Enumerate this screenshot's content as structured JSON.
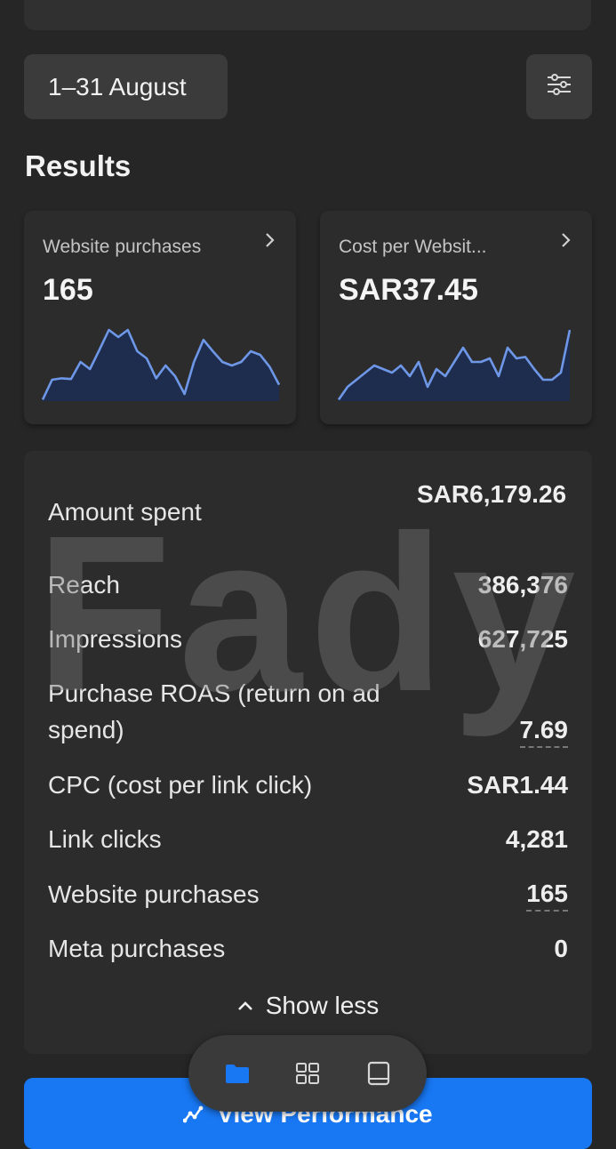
{
  "header": {
    "date_range": "1–31 August",
    "section_title": "Results"
  },
  "metrics": [
    {
      "label": "Website purchases",
      "value": "165",
      "trend": [
        0.02,
        0.3,
        0.32,
        0.31,
        0.55,
        0.45,
        0.72,
        1.0,
        0.9,
        1.0,
        0.7,
        0.6,
        0.32,
        0.5,
        0.35,
        0.1,
        0.55,
        0.86,
        0.7,
        0.55,
        0.5,
        0.55,
        0.7,
        0.65,
        0.48,
        0.23
      ]
    },
    {
      "label": "Cost per Websit...",
      "value": "SAR37.45",
      "trend": [
        0.02,
        0.2,
        0.3,
        0.4,
        0.5,
        0.45,
        0.4,
        0.5,
        0.35,
        0.55,
        0.2,
        0.45,
        0.35,
        0.55,
        0.75,
        0.55,
        0.55,
        0.6,
        0.35,
        0.75,
        0.6,
        0.62,
        0.45,
        0.3,
        0.3,
        0.4,
        1.0
      ]
    }
  ],
  "summary": {
    "rows": [
      {
        "label": "Amount spent",
        "value": "SAR6,179.26"
      },
      {
        "label": "Reach",
        "value": "386,376"
      },
      {
        "label": "Impressions",
        "value": "627,725"
      },
      {
        "label": "Purchase ROAS (return on ad spend)",
        "value": "7.69"
      },
      {
        "label": "CPC (cost per link click)",
        "value": "SAR1.44"
      },
      {
        "label": "Link clicks",
        "value": "4,281"
      },
      {
        "label": "Website purchases",
        "value": "165"
      },
      {
        "label": "Meta purchases",
        "value": "0"
      }
    ],
    "show_less": "Show less"
  },
  "watermark": "Fady",
  "footer": {
    "view_performance": "View Performance"
  },
  "tabs": [
    {
      "icon": "folder-icon",
      "active": true
    },
    {
      "icon": "grid-icon",
      "active": false
    },
    {
      "icon": "tablet-icon",
      "active": false
    }
  ],
  "colors": {
    "background": "#262626",
    "card": "#2c2c2c",
    "accent": "#1877f2",
    "spark_line": "#6e97e8",
    "spark_fill": "#1e2d4d"
  }
}
